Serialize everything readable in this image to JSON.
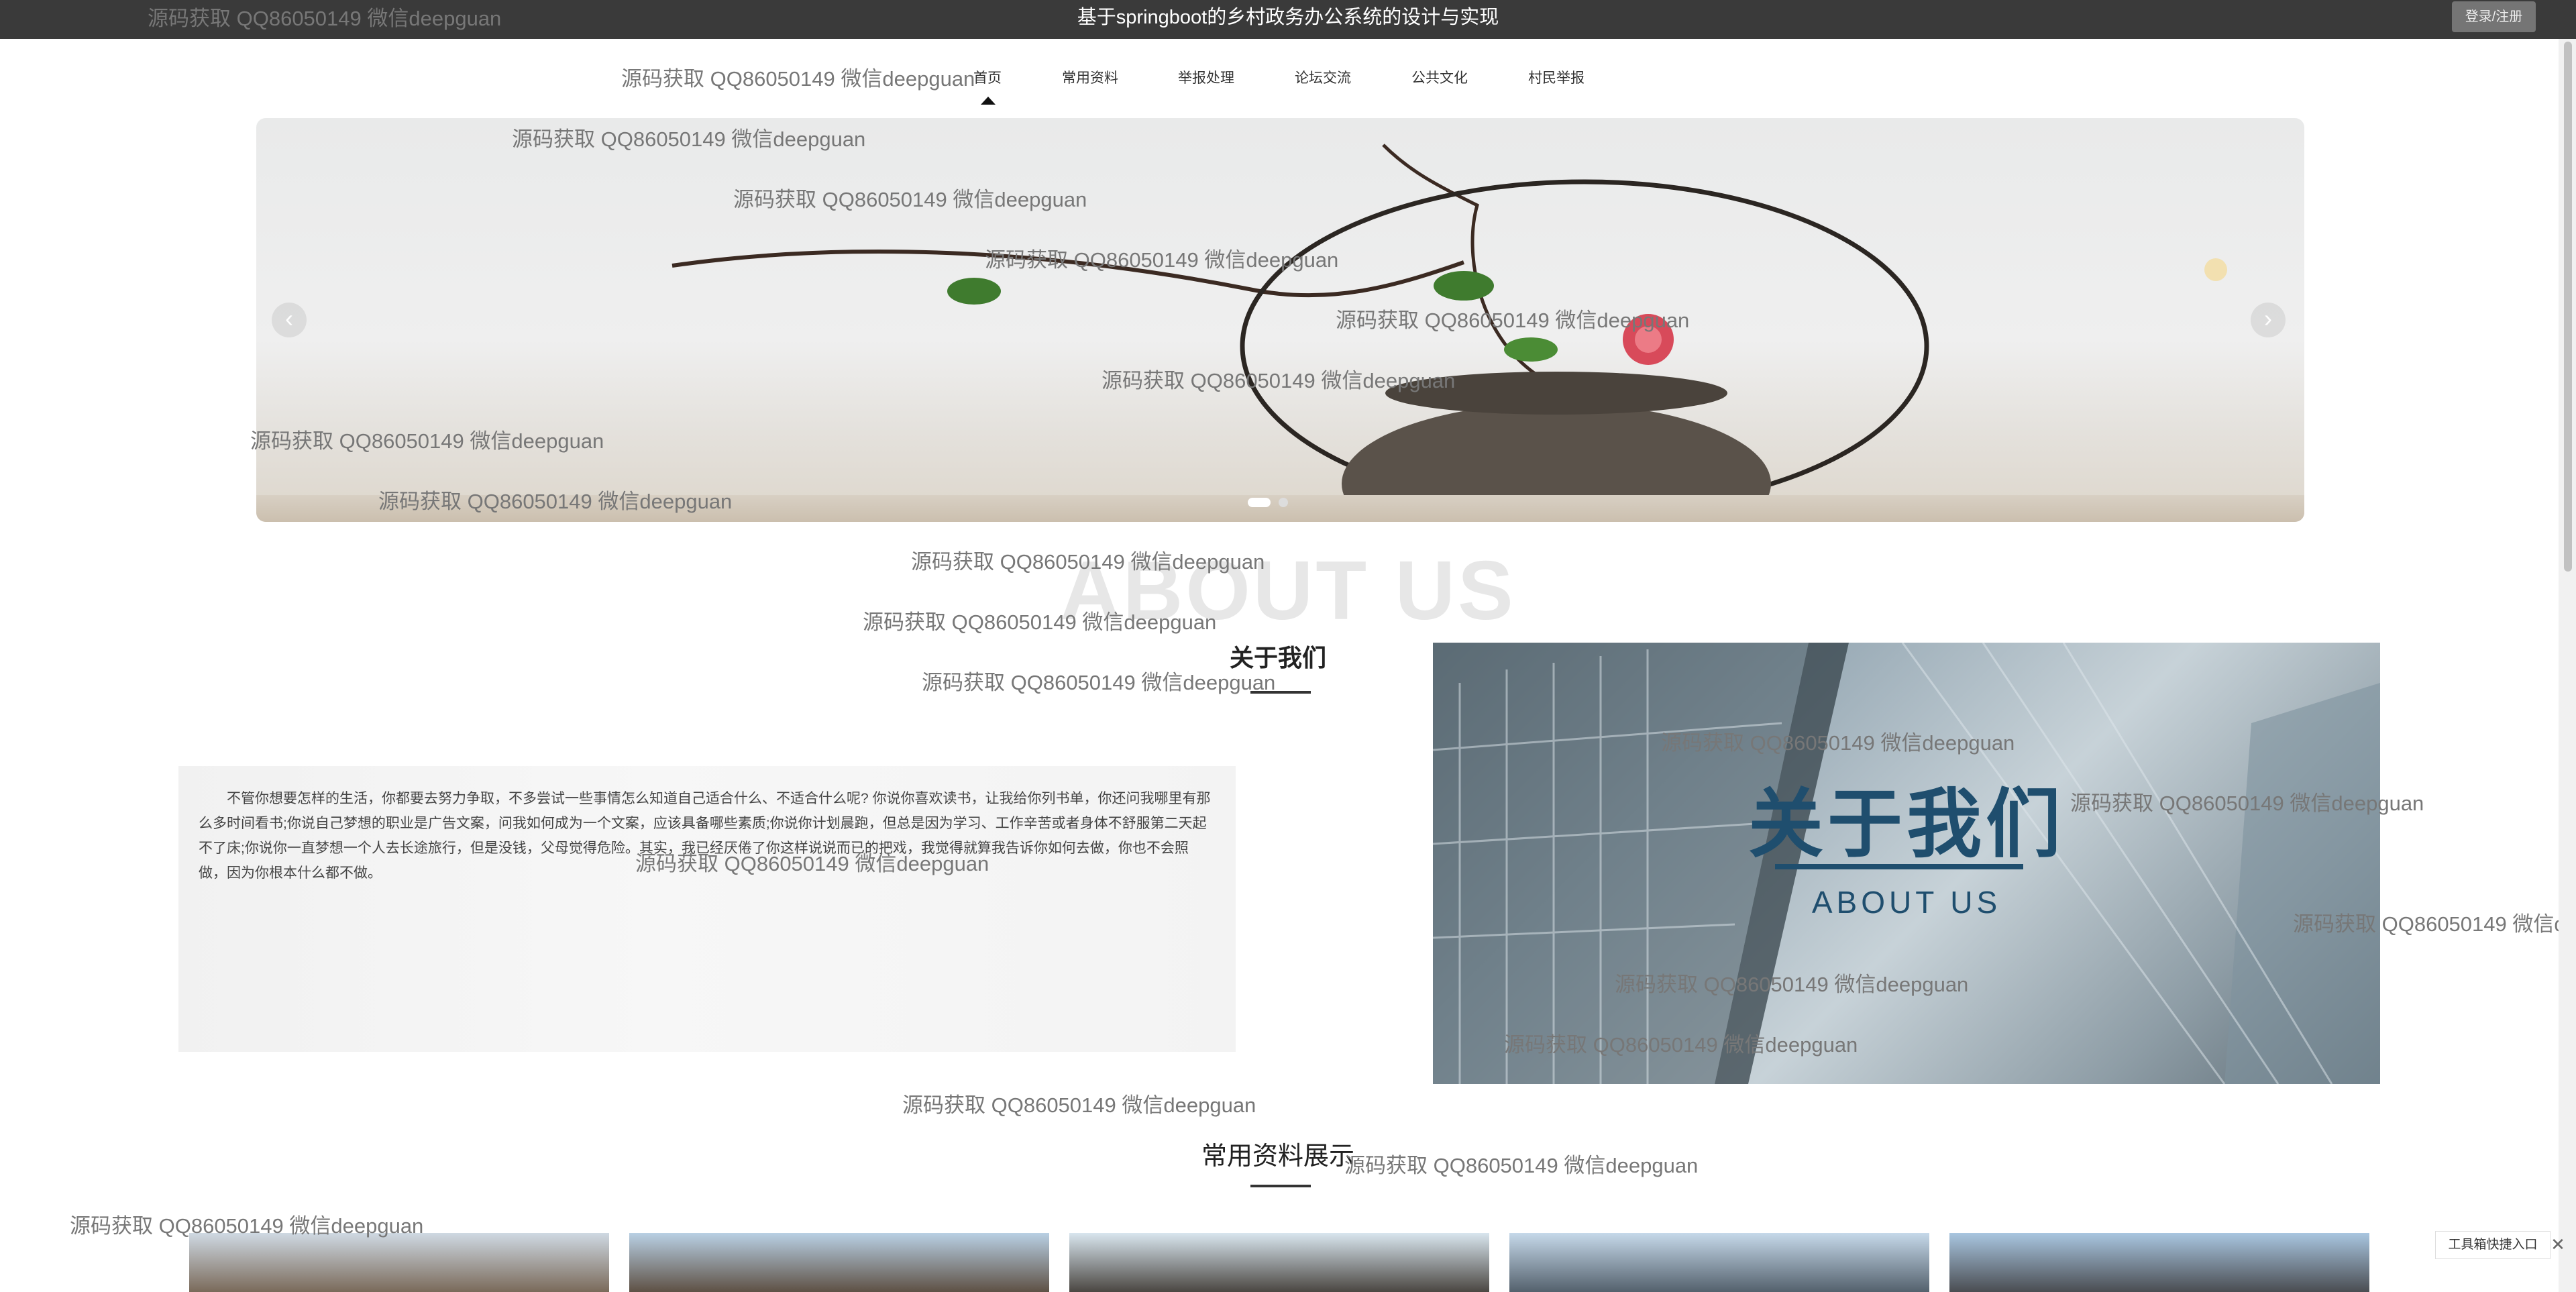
{
  "topbar": {
    "title": "基于springboot的乡村政务办公系统的设计与实现",
    "login_label": "登录/注册"
  },
  "nav": {
    "items": [
      {
        "label": "首页"
      },
      {
        "label": "常用资料"
      },
      {
        "label": "举报处理"
      },
      {
        "label": "论坛交流"
      },
      {
        "label": "公共文化"
      },
      {
        "label": "村民举报"
      }
    ],
    "active_index": 0
  },
  "banner": {
    "prev_icon": "‹",
    "next_icon": "›",
    "slide_count": 2,
    "active_slide": 0
  },
  "about": {
    "bg_text": "ABOUT US",
    "title": "关于我们",
    "text": "不管你想要怎样的生活，你都要去努力争取，不多尝试一些事情怎么知道自己适合什么、不适合什么呢? 你说你喜欢读书，让我给你列书单，你还问我哪里有那么多时间看书;你说自己梦想的职业是广告文案，问我如何成为一个文案，应该具备哪些素质;你说你计划晨跑，但总是因为学习、工作辛苦或者身体不舒服第二天起不了床;你说你一直梦想一个人去长途旅行，但是没钱，父母觉得危险。其实，我已经厌倦了你这样说说而已的把戏，我觉得就算我告诉你如何去做，你也不会照做，因为你根本什么都不做。",
    "image_title": "关于我们",
    "image_sub": "ABOUT US"
  },
  "materials": {
    "title": "常用资料展示"
  },
  "watermark": "源码获取 QQ86050149 微信deepguan",
  "toolbox": {
    "label": "工具箱快捷入口",
    "close": "✕"
  },
  "colors": {
    "topbar": "#3a3a3a",
    "accent": "#1f4e6e"
  }
}
